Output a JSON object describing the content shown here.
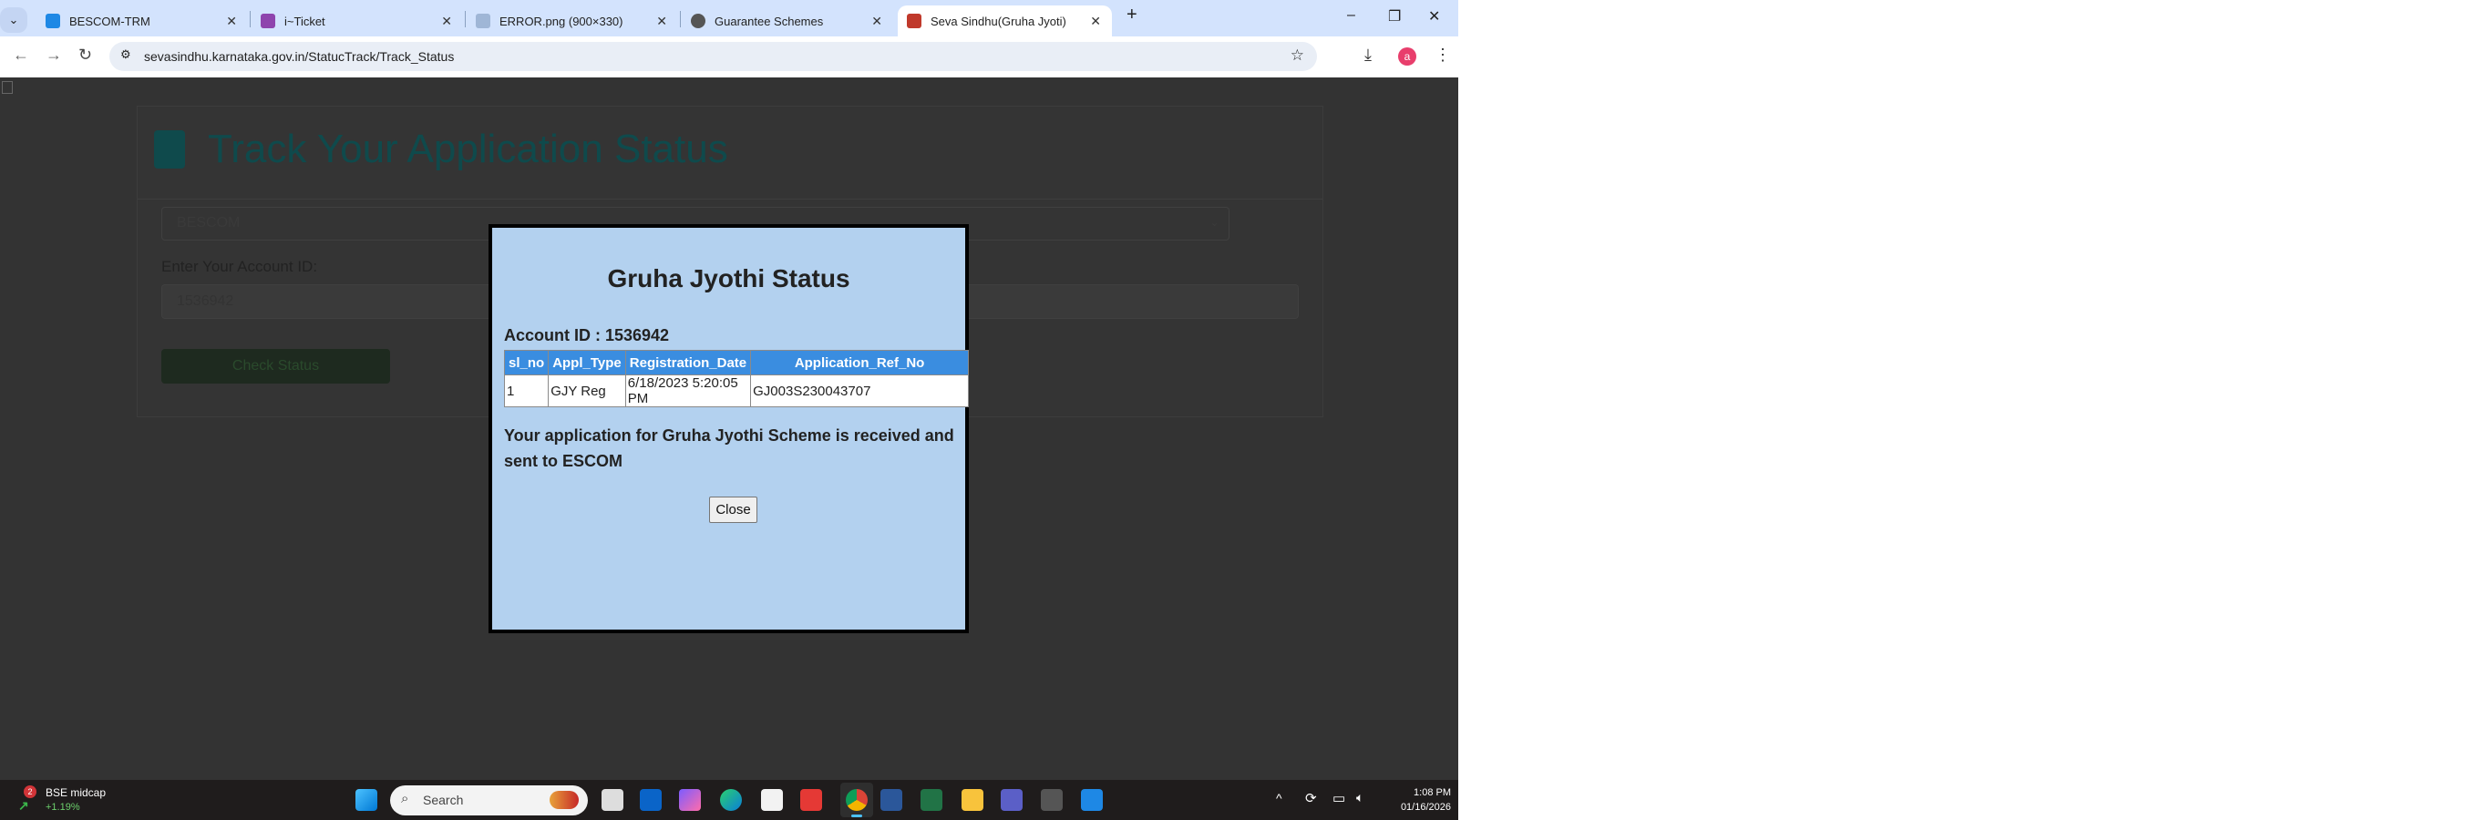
{
  "browser": {
    "tabs": [
      {
        "title": "BESCOM-TRM",
        "color": "#1e88e5"
      },
      {
        "title": "i~Ticket",
        "color": "#8e44ad"
      },
      {
        "title": "ERROR.png (900×330)",
        "color": "#9fb6d6"
      },
      {
        "title": "Guarantee Schemes",
        "color": "#555555"
      },
      {
        "title": "Seva Sindhu(Gruha Jyoti)",
        "color": "#c0392b",
        "active": true
      }
    ],
    "new_tab": "+",
    "url": "sevasindhu.karnataka.gov.in/StatucTrack/Track_Status",
    "profile_initial": "a"
  },
  "page": {
    "title": "Track Your Application Status",
    "escom_select": "BESCOM",
    "account_label": "Enter Your Account ID:",
    "account_value": "1536942",
    "check_button": "Check Status"
  },
  "dialog": {
    "title": "Gruha Jyothi Status",
    "account_line": "Account ID : 1536942",
    "columns": [
      "sl_no",
      "Appl_Type",
      "Registration_Date",
      "Application_Ref_No"
    ],
    "rows": [
      [
        "1",
        "GJY Reg",
        "6/18/2023 5:20:05 PM",
        "GJ003S230043707"
      ]
    ],
    "message": "Your application for Gruha Jyothi Scheme is received and sent to ESCOM",
    "close_button": "Close"
  },
  "taskbar": {
    "widget_name": "BSE midcap",
    "widget_change": "+1.19%",
    "widget_badge": "2",
    "search_placeholder": "Search",
    "time": "1:08 PM",
    "date": "01/16/2026"
  }
}
